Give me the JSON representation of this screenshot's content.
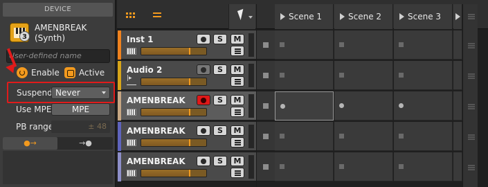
{
  "device": {
    "panel_title": "DEVICE",
    "name": "AMENBREAK",
    "type": "(Synth)",
    "badge": "3",
    "name_placeholder": "User-defined name",
    "enable_label": "Enable",
    "active_label": "Active",
    "suspend_label": "Suspend",
    "suspend_value": "Never",
    "use_mpe_label": "Use MPE",
    "mpe_button": "MPE",
    "pb_range_label": "PB range",
    "pb_range_value": "± 48",
    "tab_left": "●→",
    "tab_right": "→●"
  },
  "scenes": [
    "Scene 1",
    "Scene 2",
    "Scene 3"
  ],
  "tracks": [
    {
      "name": "Inst 1",
      "color": "#f0821e",
      "type": "keys",
      "fader": 0.72
    },
    {
      "name": "Audio 2",
      "color": "#d7a519",
      "type": "wave",
      "fader": 0.72
    },
    {
      "name": "AMENBREAK",
      "color": "#c7a783",
      "type": "keys",
      "fader": 0.72
    },
    {
      "name": "AMENBREAK",
      "color": "#5f64bd",
      "type": "keys",
      "fader": 0.72
    },
    {
      "name": "AMENBREAK",
      "color": "#8e8fc9",
      "type": "keys",
      "fader": 0.72
    }
  ],
  "buttons": {
    "solo": "S",
    "mute": "M"
  },
  "colors": {
    "accent": "#f39a1e",
    "highlight": "#e11b1b",
    "armed": "#e01818"
  }
}
